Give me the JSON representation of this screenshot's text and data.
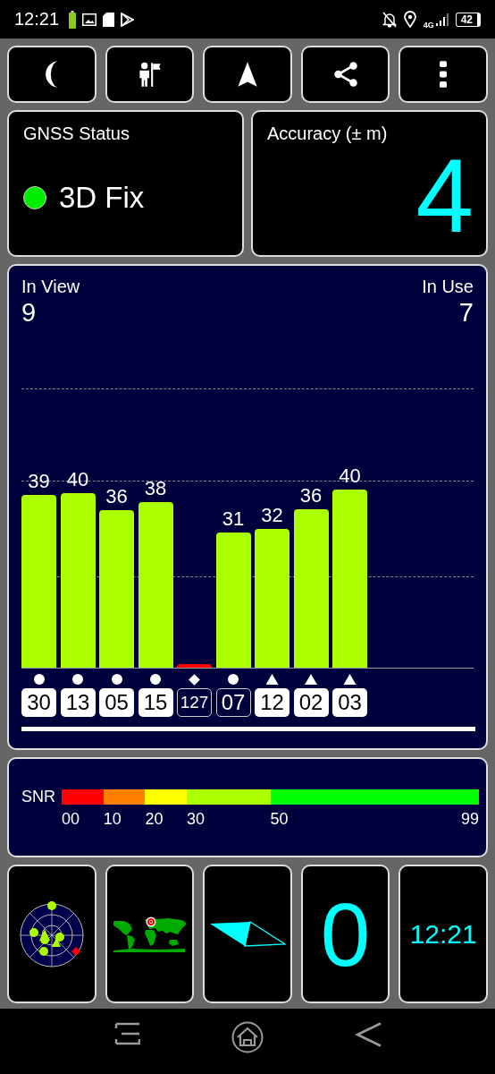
{
  "status_bar": {
    "time": "12:21",
    "network": "4G",
    "battery": "42"
  },
  "gnss_status": {
    "title": "GNSS Status",
    "value": "3D Fix",
    "color": "#00ee00"
  },
  "accuracy": {
    "title": "Accuracy (± m)",
    "value": "4"
  },
  "satellites": {
    "in_view_label": "In View",
    "in_view": "9",
    "in_use_label": "In Use",
    "in_use": "7",
    "items": [
      {
        "prn": "30",
        "snr": "39",
        "color": "#aaff00",
        "kind": "circle",
        "used": true
      },
      {
        "prn": "13",
        "snr": "40",
        "color": "#aaff00",
        "kind": "circle",
        "used": true
      },
      {
        "prn": "05",
        "snr": "36",
        "color": "#aaff00",
        "kind": "circle",
        "used": true
      },
      {
        "prn": "15",
        "snr": "38",
        "color": "#aaff00",
        "kind": "circle",
        "used": true
      },
      {
        "prn": "127",
        "color": "#ff0000",
        "kind": "diamond",
        "used": false
      },
      {
        "prn": "07",
        "snr": "31",
        "color": "#aaff00",
        "kind": "circle",
        "used": false
      },
      {
        "prn": "12",
        "snr": "32",
        "color": "#aaff00",
        "kind": "triangle",
        "used": true
      },
      {
        "prn": "02",
        "snr": "36",
        "color": "#aaff00",
        "kind": "triangle",
        "used": true
      },
      {
        "prn": "03",
        "snr": "40",
        "color": "#aaff00",
        "kind": "triangle",
        "used": true
      }
    ]
  },
  "snr_legend": {
    "label": "SNR",
    "end_label": "99",
    "segments": [
      {
        "label": "00",
        "color": "#ff0000"
      },
      {
        "label": "10",
        "color": "#ff8000"
      },
      {
        "label": "20",
        "color": "#ffff00"
      },
      {
        "label": "30",
        "color": "#aaff00"
      },
      {
        "label": "50",
        "color": "#00ff00"
      }
    ]
  },
  "tiles": [
    {
      "kind": "skyplot"
    },
    {
      "kind": "worldmap"
    },
    {
      "kind": "compass"
    },
    {
      "kind": "speed",
      "value": "0"
    },
    {
      "kind": "clock",
      "value": "12:21"
    }
  ]
}
